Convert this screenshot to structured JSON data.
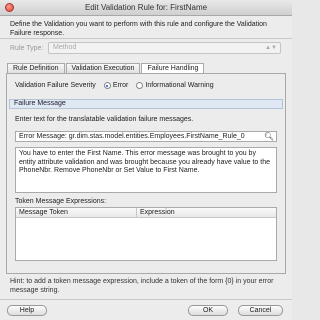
{
  "window": {
    "title": "Edit Validation Rule for: FirstName"
  },
  "header": {
    "description": "Define the Validation you want to perform with this rule and configure the Validation Failure response."
  },
  "rule_type": {
    "label": "Rule Type:",
    "value": "Method"
  },
  "tabs": [
    {
      "label": "Rule Definition",
      "active": false
    },
    {
      "label": "Validation Execution",
      "active": false
    },
    {
      "label": "Failure Handling",
      "active": true
    }
  ],
  "failure_handling": {
    "severity_label": "Validation Failure Severity",
    "severity_options": [
      {
        "label": "Error",
        "checked": true
      },
      {
        "label": "Informational Warning",
        "checked": false
      }
    ],
    "section_title": "Failure Message",
    "hint": "Enter text for the translatable validation failure messages.",
    "search_value": "Error Message: gr.dim.stas.model.entities.Employees.FirstName_Rule_0",
    "message_text": "You have to enter the First Name. This error message was brought to you by entity attribute validation and was brought because you already have value to the PhoneNbr. Remove PhoneNbr or Set Value to First Name.",
    "token_label": "Token Message Expressions:",
    "token_columns": [
      "Message Token",
      "Expression"
    ]
  },
  "footer": {
    "hint": "Hint: to add a token message expression, include a token of the form {0} in your error message string.",
    "help_label": "Help",
    "ok_label": "OK",
    "cancel_label": "Cancel"
  }
}
